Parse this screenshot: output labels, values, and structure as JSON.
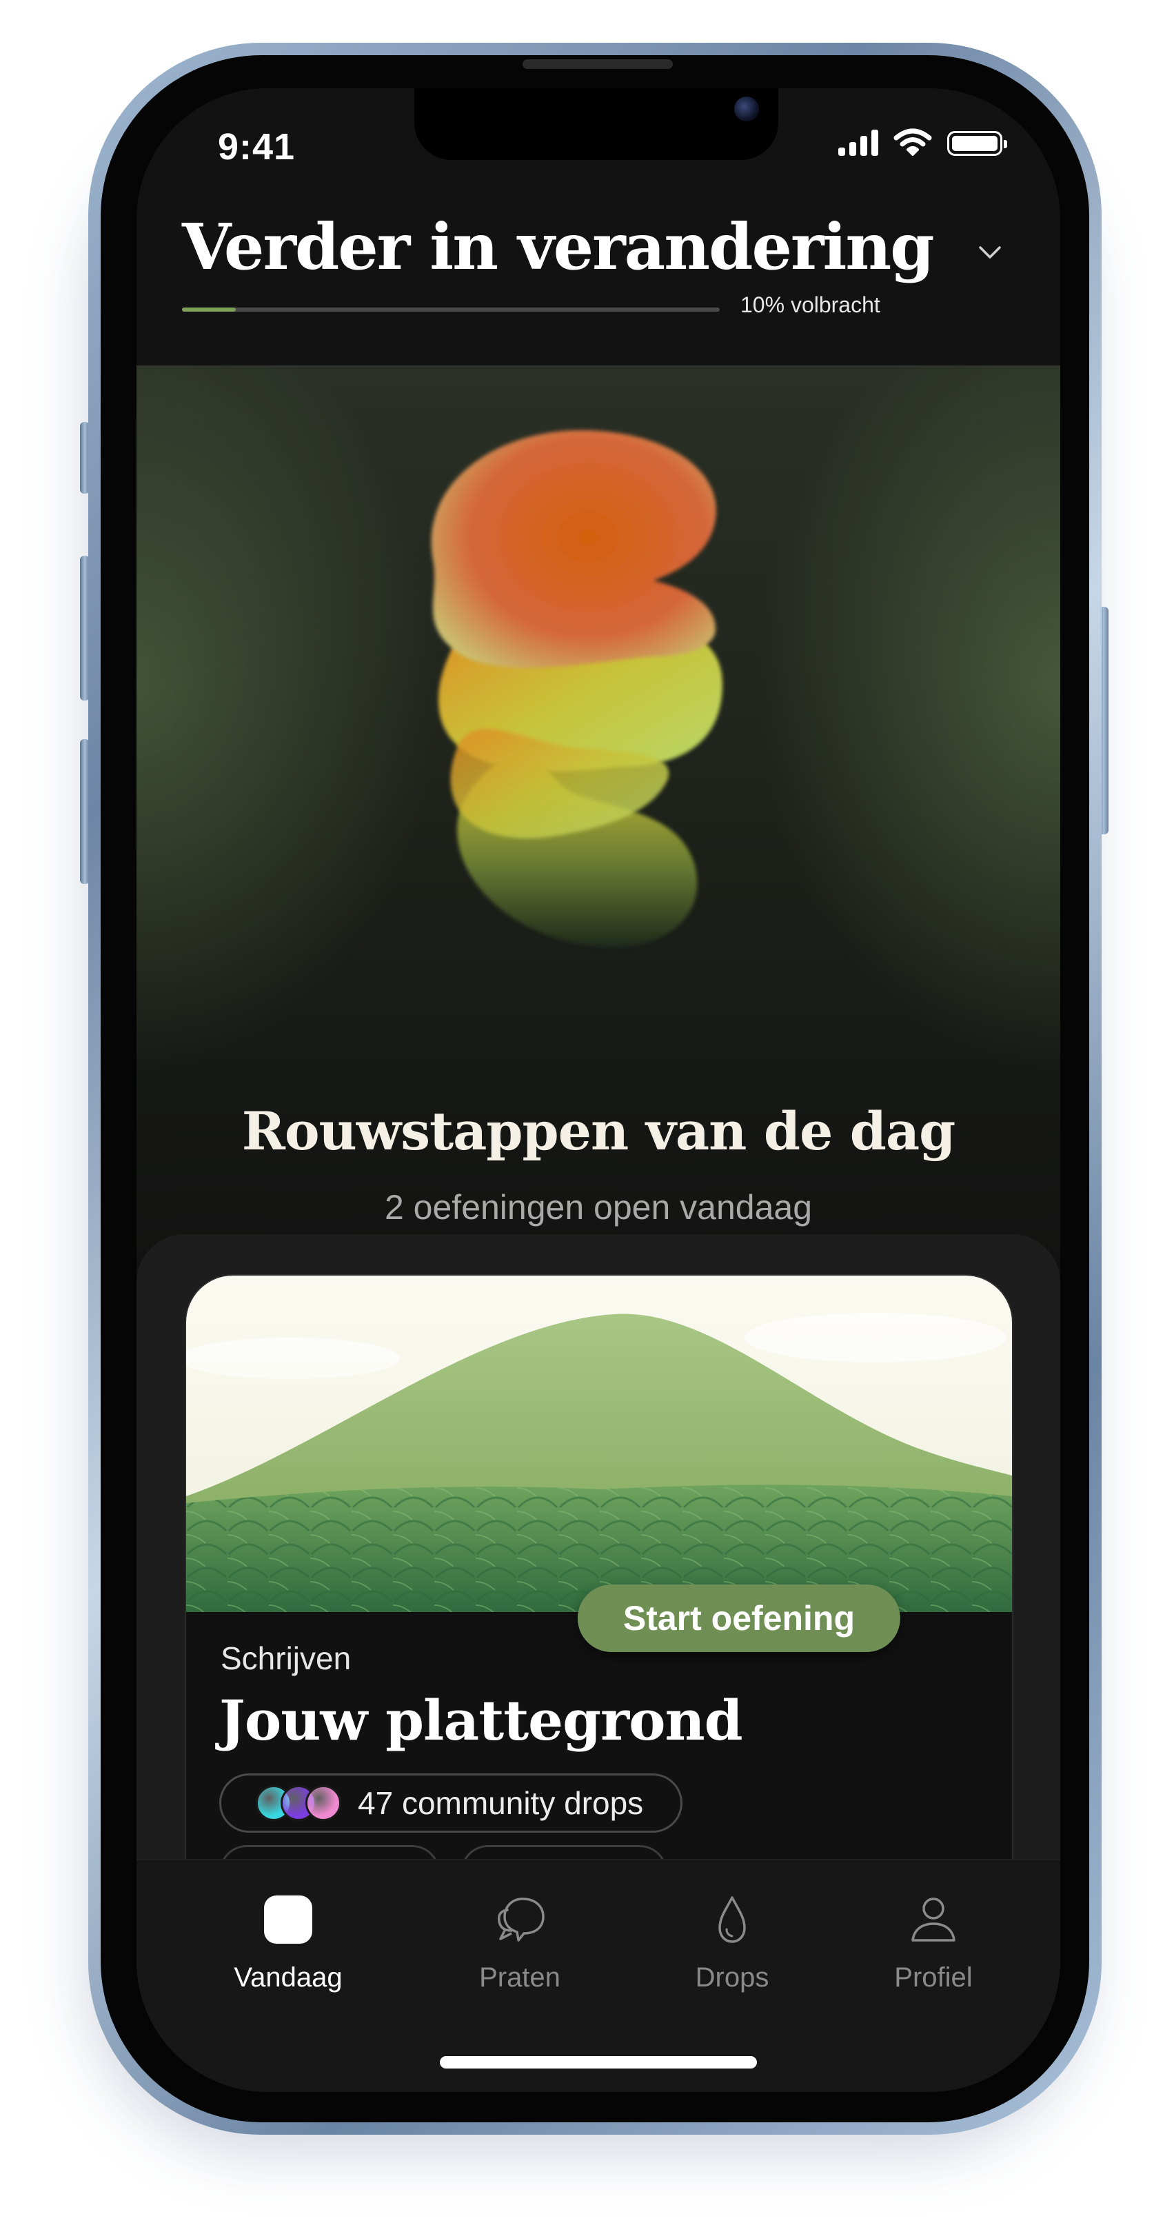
{
  "status_bar": {
    "time": "9:41"
  },
  "header": {
    "title": "Verder in verandering",
    "progress_percent": 10,
    "progress_label": "10% volbracht"
  },
  "hero": {
    "title": "Rouwstappen van de dag",
    "subtitle": "2 oefeningen open vandaag"
  },
  "exercise_card": {
    "start_button": "Start oefening",
    "category": "Schrijven",
    "title": "Jouw plattegrond",
    "community_drops": "47 community drops",
    "avatar_colors": [
      "#38d6e0",
      "#7c3ee0",
      "#f08ad0"
    ]
  },
  "tabbar": {
    "tabs": [
      {
        "label": "Vandaag",
        "icon": "square-icon",
        "active": true
      },
      {
        "label": "Praten",
        "icon": "chat-bubbles-icon",
        "active": false
      },
      {
        "label": "Drops",
        "icon": "drop-icon",
        "active": false
      },
      {
        "label": "Profiel",
        "icon": "person-icon",
        "active": false
      }
    ]
  },
  "colors": {
    "accent_green": "#6f8f55",
    "progress_fill": "#7da05a",
    "background": "#121212"
  }
}
